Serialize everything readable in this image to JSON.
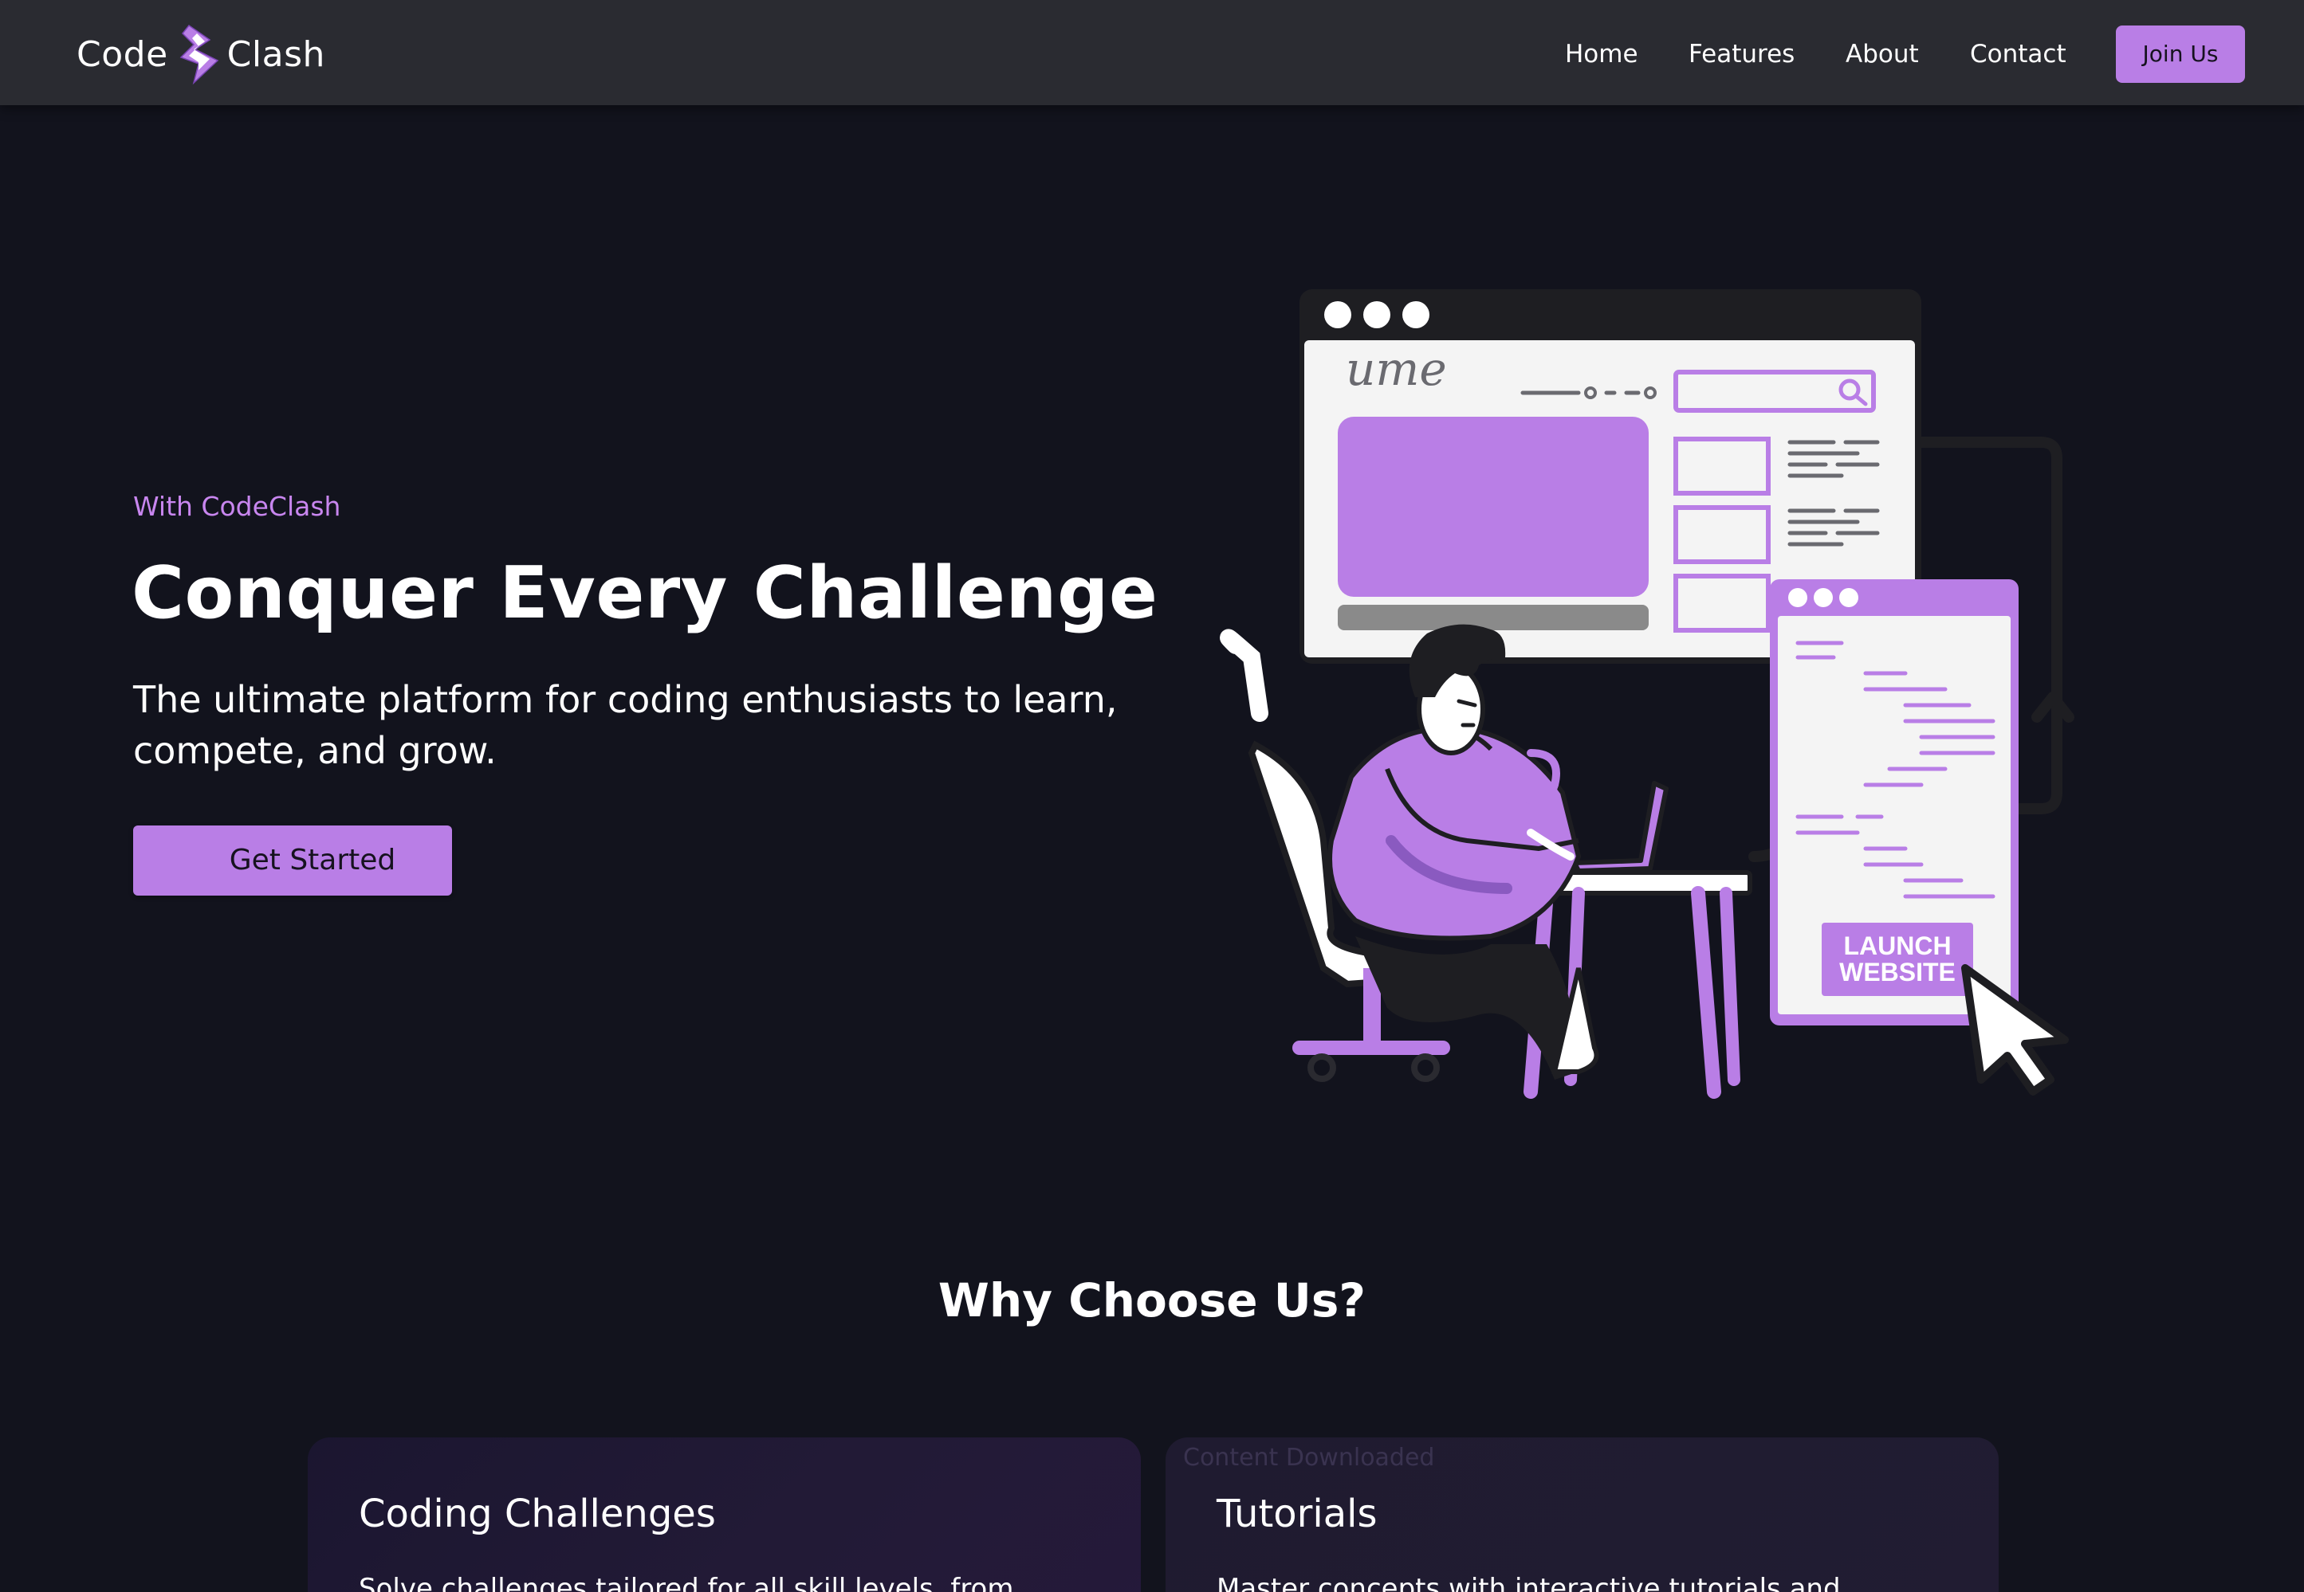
{
  "navbar": {
    "logo": {
      "left_text": "Code",
      "right_text": "Clash",
      "icon": "lightning-bolt-icon"
    },
    "links": [
      "Home",
      "Features",
      "About",
      "Contact"
    ],
    "cta_label": "Join Us"
  },
  "hero": {
    "tagline": "With CodeClash",
    "title": "Conquer Every Challenge",
    "subtitle": "The ultimate platform for coding enthusiasts to learn, compete, and grow.",
    "cta_label": "Get Started",
    "illustration": {
      "name": "developer-launching-website-illustration",
      "header_scribble": "ume",
      "launch_button_line1": "LAUNCH",
      "launch_button_line2": "WEBSITE"
    }
  },
  "why": {
    "title": "Why Choose Us?",
    "cards": [
      {
        "title": "Coding Challenges",
        "description": "Solve challenges tailored for all skill levels, from",
        "overlay": ""
      },
      {
        "title": "Tutorials",
        "description": "Master concepts with interactive tutorials and",
        "overlay": "Content Downloaded"
      }
    ]
  },
  "colors": {
    "background": "#12131d",
    "navbar": "#2a2b31",
    "accent": "#b97ee6",
    "tagline": "#c886ef",
    "text": "#ffffff"
  }
}
